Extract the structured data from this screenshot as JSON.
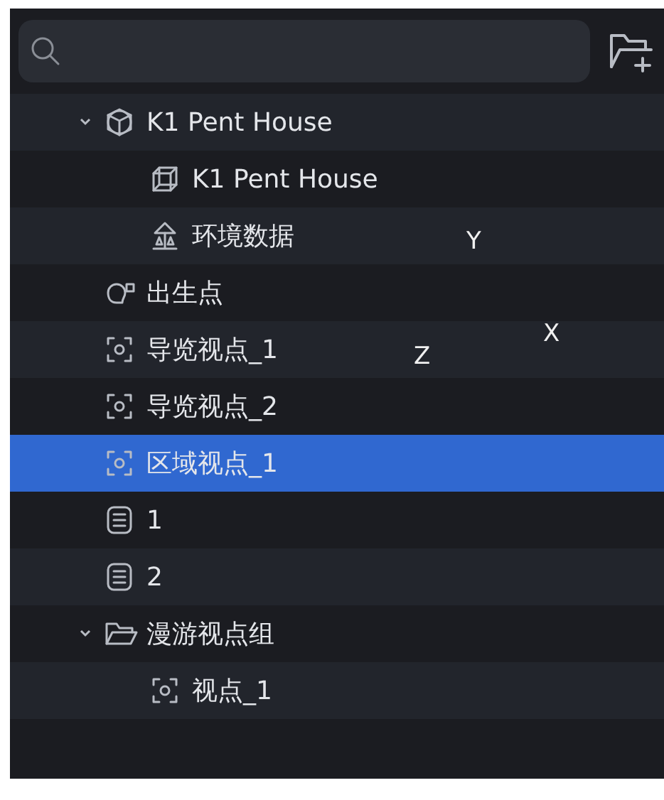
{
  "tree": [
    {
      "label": "K1 Pent House",
      "kind": "model",
      "expanded": true,
      "selected": false,
      "children": [
        {
          "label": "K1 Pent House",
          "kind": "mesh",
          "selected": false
        },
        {
          "label": "环境数据",
          "kind": "environment",
          "selected": false
        }
      ]
    },
    {
      "label": "出生点",
      "kind": "spawn",
      "selected": false
    },
    {
      "label": "导览视点_1",
      "kind": "viewpoint",
      "selected": false
    },
    {
      "label": "导览视点_2",
      "kind": "viewpoint",
      "selected": false
    },
    {
      "label": "区域视点_1",
      "kind": "viewpoint",
      "selected": true
    },
    {
      "label": "1",
      "kind": "note",
      "selected": false
    },
    {
      "label": "2",
      "kind": "note",
      "selected": false
    },
    {
      "label": "漫游视点组",
      "kind": "folder",
      "expanded": true,
      "selected": false,
      "children": [
        {
          "label": "视点_1",
          "kind": "viewpoint",
          "selected": false
        }
      ]
    }
  ],
  "axis_labels": [
    {
      "text": "Y"
    },
    {
      "text": "X"
    },
    {
      "text": "Z"
    }
  ]
}
